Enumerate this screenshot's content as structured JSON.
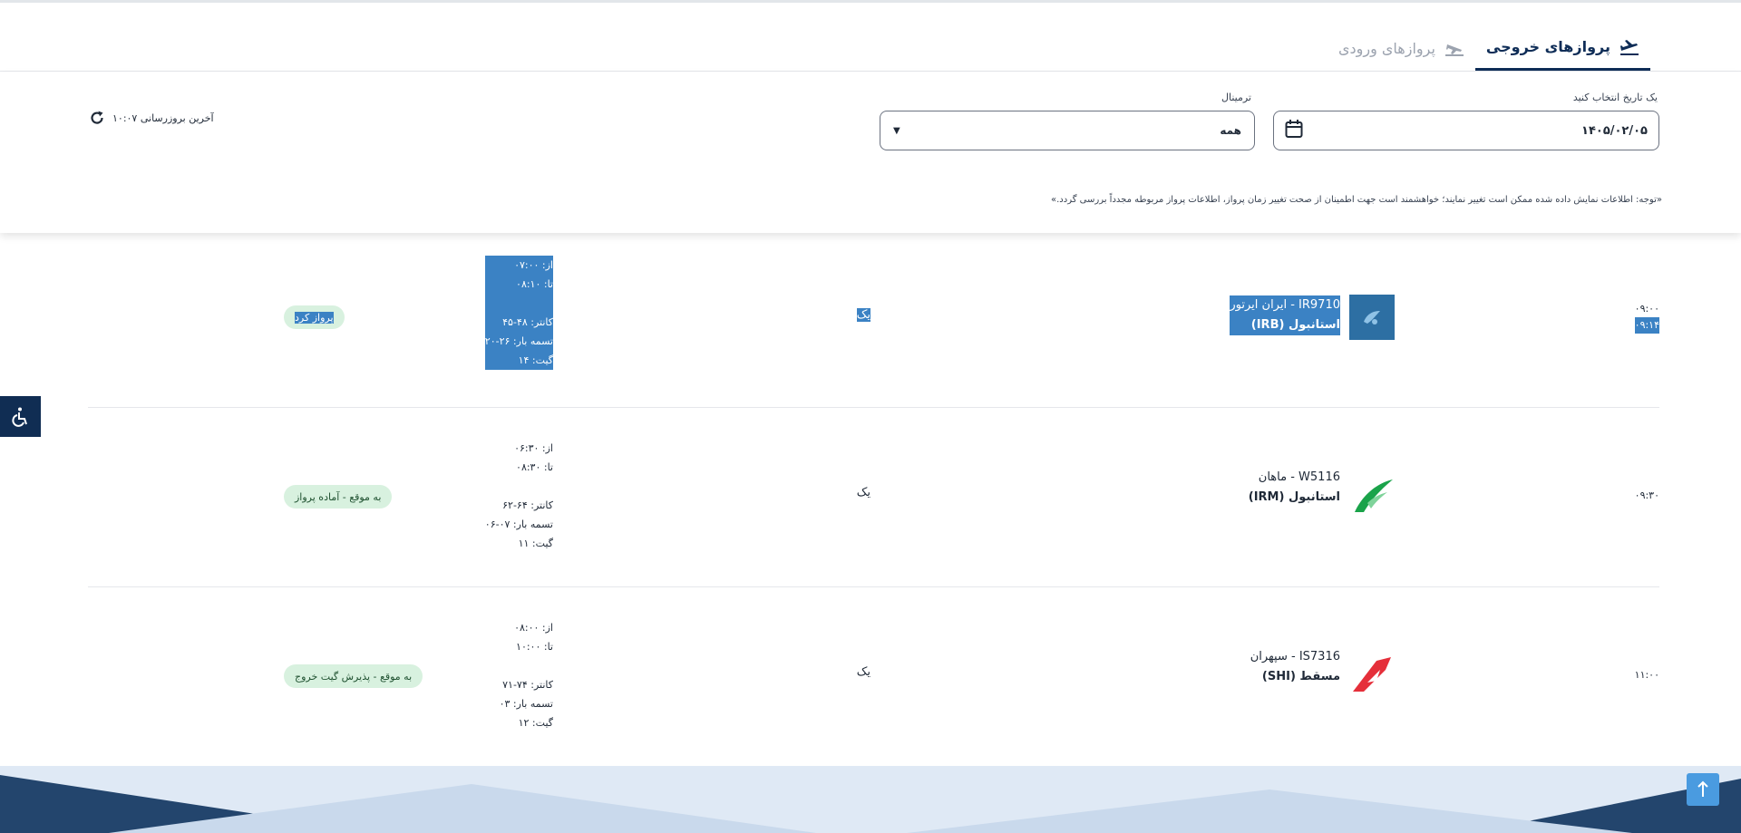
{
  "tabs": {
    "departures": "پروازهای خروجی",
    "arrivals": "پروازهای ورودی"
  },
  "filters": {
    "date_label": "یک تاریخ انتخاب کنید",
    "date_value": "۱۴۰۵/۰۲/۰۵",
    "terminal_label": "ترمینال",
    "terminal_value": "همه",
    "last_update": "آخرین بروزرسانی ۱۰:۰۷",
    "notice": "«توجه: اطلاعات نمایش داده شده ممکن است تغییر نمایند؛ خواهشمند است جهت اطمینان از صحت تغییر زمان پرواز، اطلاعات پرواز مربوطه مجدداً بررسی گردد.»"
  },
  "flights": [
    {
      "time_planned": "۰۹:۰۰",
      "time_actual": "۰۹:۱۴",
      "flight": "IR9710 - ایران ایرتور",
      "destination": "استانبول (IRB)",
      "terminal": "یک",
      "from": "از: ۰۷:۰۰",
      "to": "تا: ۰۸:۱۰",
      "counter": "کانتر: ۴۸-۴۵",
      "belt": "تسمه بار: ۲۶-۲۰",
      "gate": "گیت: ۱۴",
      "status": "پرواز کرد",
      "airline_color": "#2d6fa3"
    },
    {
      "time_planned": "۰۹:۳۰",
      "flight": "W5116 - ماهان",
      "destination": "استانبول (IRM)",
      "terminal": "یک",
      "from": "از: ۰۶:۳۰",
      "to": "تا: ۰۸:۳۰",
      "counter": "کانتر: ۶۴-۶۲",
      "belt": "تسمه بار: ۰۷-۰۶",
      "gate": "گیت: ۱۱",
      "status": "به موقع - آماده پرواز",
      "airline_color": "#1aa34a"
    },
    {
      "time_planned": "۱۱:۰۰",
      "flight": "IS7316 - سپهران",
      "destination": "مسقط (SHI)",
      "terminal": "یک",
      "from": "از: ۰۸:۰۰",
      "to": "تا: ۱۰:۰۰",
      "counter": "کانتر: ۷۴-۷۱",
      "belt": "تسمه بار: ۰۳",
      "gate": "گیت: ۱۲",
      "status": "به موقع - پذیرش گیت خروج",
      "airline_color": "#e52f3a"
    }
  ],
  "colors": {
    "primary": "#0f2d57",
    "status_bg": "#d8f1df",
    "scroll_button": "#4a9be0"
  }
}
